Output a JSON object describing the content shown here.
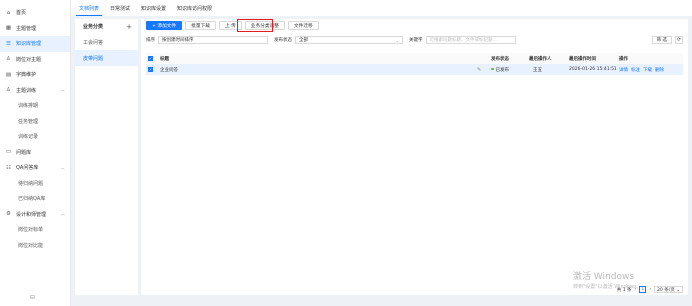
{
  "sidebar": {
    "items": [
      {
        "label": "首页",
        "icon": "home-icon",
        "glyph": "⌂"
      },
      {
        "label": "主题管理",
        "icon": "grid-icon",
        "glyph": "▦"
      },
      {
        "label": "知识库管理",
        "icon": "book-icon",
        "glyph": "☰"
      },
      {
        "label": "岗位对主题",
        "icon": "user-icon",
        "glyph": "♙"
      },
      {
        "label": "字典维护",
        "icon": "dictionary-icon",
        "glyph": "▤"
      },
      {
        "label": "主题训练",
        "icon": "training-icon",
        "glyph": "♙"
      },
      {
        "label": "训练排期"
      },
      {
        "label": "任务管理"
      },
      {
        "label": "训练记录"
      },
      {
        "label": "问题库",
        "icon": "question-bank-icon",
        "glyph": "▭"
      },
      {
        "label": "QA问答库",
        "icon": "qa-icon",
        "glyph": "☷"
      },
      {
        "label": "待归纳问题"
      },
      {
        "label": "已归纳QA库"
      },
      {
        "label": "设计和师管理",
        "icon": "designer-icon",
        "glyph": "⚙"
      },
      {
        "label": "岗位对标单"
      },
      {
        "label": "岗位对比能"
      }
    ],
    "collapse_glyph": "⊟"
  },
  "tabs": [
    "文档列表",
    "日常测试",
    "知识库设置",
    "知识库访问权限"
  ],
  "category": {
    "title": "业务分类",
    "add_glyph": "+",
    "items": [
      "工会问答",
      "皮带问题"
    ]
  },
  "toolbar": {
    "add": "+ 添加文件",
    "batch_download": "批量下载",
    "upload": "上 传",
    "business_category": "业务分类调整",
    "migrate": "文件迁移"
  },
  "filters": {
    "sort_label": "排序",
    "sort_value": "按创建时间排序",
    "status_label": "发布状态",
    "status_value": "全部",
    "keyword_label": "关键字",
    "keyword_placeholder": "可搜索问题标题、文件或标记题...",
    "filter_button": "筛 选",
    "refresh_glyph": "⟳"
  },
  "table": {
    "headers": {
      "title": "标题",
      "status": "发布状态",
      "operator": "最后操作人",
      "time": "最后操作时间",
      "actions": "操作"
    },
    "rows": [
      {
        "title": "企业问答",
        "status": "已发布",
        "operator": "王五",
        "time": "2026-01-26 15:41:51",
        "actions": [
          "详情",
          "标注",
          "下载",
          "删除"
        ]
      }
    ]
  },
  "pager": {
    "total": "共 1 条",
    "prev": "‹",
    "page": "1",
    "next": "›",
    "size": "20 条/页 ⌄"
  },
  "watermark": {
    "line1": "激活 Windows",
    "line2": "转到\"设置\"以激活 Windows。"
  },
  "colors": {
    "accent": "#1677ff",
    "highlight_box": "#e02020",
    "status_green": "#52c41a"
  }
}
